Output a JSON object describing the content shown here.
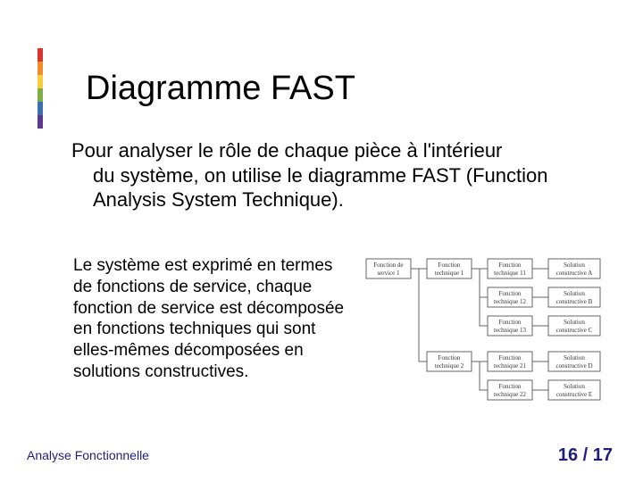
{
  "accent_colors": [
    "#d7342f",
    "#f08c2a",
    "#f5ce3a",
    "#7cae47",
    "#3a6fb0",
    "#5a3a8e"
  ],
  "title": "Diagramme FAST",
  "intro_line1": "Pour analyser le rôle de chaque pièce à l'intérieur",
  "intro_rest": "du système, on utilise le diagramme FAST (Function Analysis System Technique).",
  "body": "Le système est exprimé en termes de fonctions de service, chaque fonction de service est décomposée en fonctions techniques qui sont elles-mêmes décomposées en solutions constructives.",
  "footer_left": "Analyse Fonctionnelle",
  "footer_right": "16 / 17",
  "diagram": {
    "col1": [
      {
        "l1": "Fonction de",
        "l2": "service 1"
      }
    ],
    "col2": [
      {
        "l1": "Fonction",
        "l2": "technique 1"
      },
      {
        "l1": "Fonction",
        "l2": "technique 2"
      }
    ],
    "col3": [
      {
        "l1": "Fonction",
        "l2": "technique 11"
      },
      {
        "l1": "Fonction",
        "l2": "technique 12"
      },
      {
        "l1": "Fonction",
        "l2": "technique 13"
      },
      {
        "l1": "Fonction",
        "l2": "technique 21"
      },
      {
        "l1": "Fonction",
        "l2": "technique 22"
      }
    ],
    "col4": [
      {
        "l1": "Solution",
        "l2": "constructive A"
      },
      {
        "l1": "Solution",
        "l2": "constructive B"
      },
      {
        "l1": "Solution",
        "l2": "constructive C"
      },
      {
        "l1": "Solution",
        "l2": "constructive D"
      },
      {
        "l1": "Solution",
        "l2": "constructive E"
      }
    ]
  }
}
